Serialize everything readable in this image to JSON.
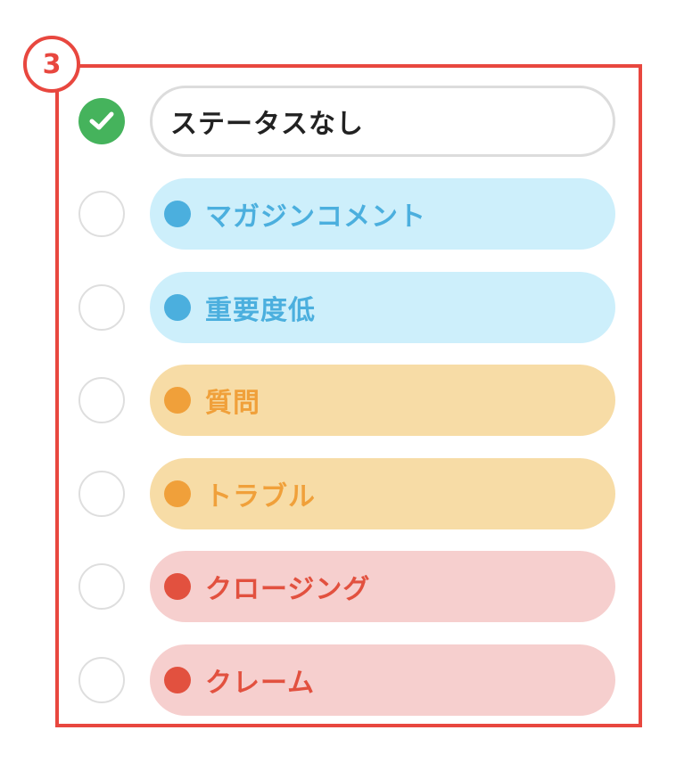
{
  "step_badge": "3",
  "colors": {
    "frame": "#e8473f",
    "checked": "#45b35c"
  },
  "options": [
    {
      "label": "ステータスなし",
      "selected": true,
      "style": "none"
    },
    {
      "label": "マガジンコメント",
      "selected": false,
      "style": "blue",
      "bg": "#cdeffb",
      "dot": "#4bafde",
      "text": "#4bafde"
    },
    {
      "label": "重要度低",
      "selected": false,
      "style": "blue",
      "bg": "#cdeffb",
      "dot": "#4bafde",
      "text": "#4bafde"
    },
    {
      "label": "質問",
      "selected": false,
      "style": "orange",
      "bg": "#f7dca6",
      "dot": "#f0a03a",
      "text": "#f0a03a"
    },
    {
      "label": "トラブル",
      "selected": false,
      "style": "orange",
      "bg": "#f7dca6",
      "dot": "#f0a03a",
      "text": "#f0a03a"
    },
    {
      "label": "クロージング",
      "selected": false,
      "style": "red",
      "bg": "#f6cfce",
      "dot": "#e2513f",
      "text": "#e2513f"
    },
    {
      "label": "クレーム",
      "selected": false,
      "style": "red",
      "bg": "#f6cfce",
      "dot": "#e2513f",
      "text": "#e2513f"
    }
  ]
}
